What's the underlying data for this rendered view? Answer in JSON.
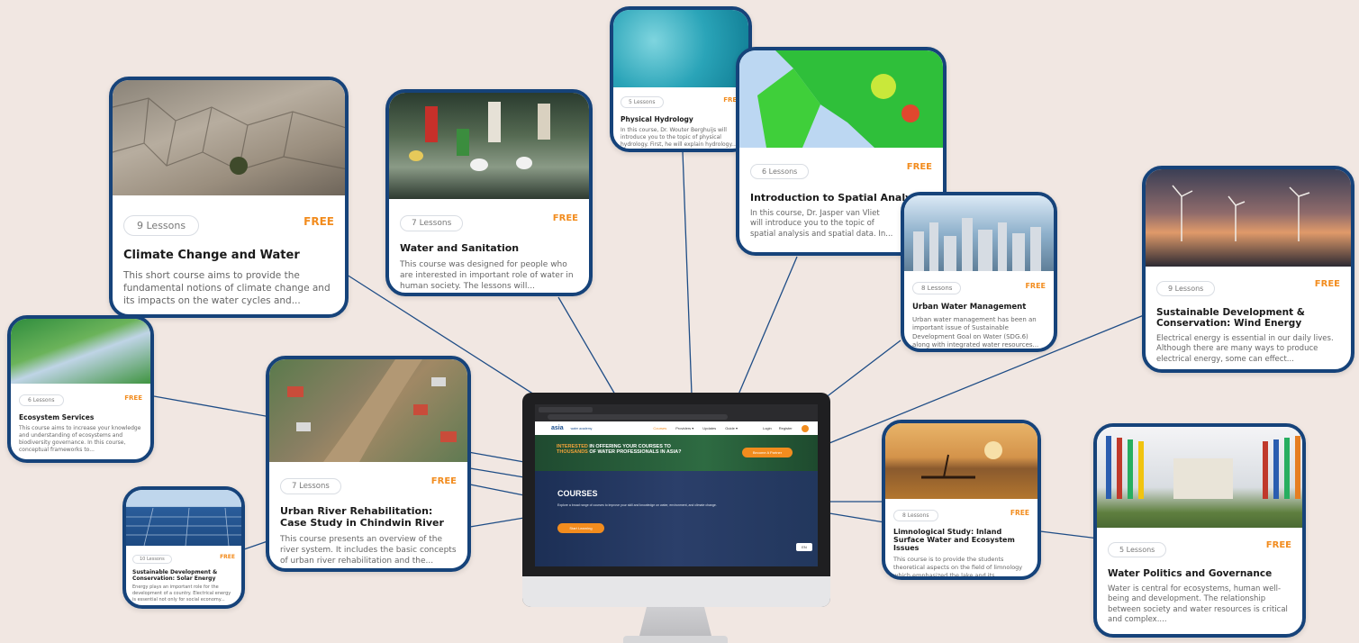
{
  "cards": {
    "climate": {
      "lessons": "9 Lessons",
      "free": "FREE",
      "title": "Climate Change and Water",
      "desc": "This short course aims to provide the fundamental notions of climate change and its impacts on the water cycles and..."
    },
    "sanitation": {
      "lessons": "7 Lessons",
      "free": "FREE",
      "title": "Water and Sanitation",
      "desc": "This course was designed for people who are interested in important role of water in human society. The lessons will..."
    },
    "hydrology": {
      "lessons": "5 Lessons",
      "free": "FREE",
      "title": "Physical Hydrology",
      "desc": "In this course, Dr. Wouter Berghuijs will introduce you to the topic of physical hydrology. First, he will explain hydrology..."
    },
    "spatial": {
      "lessons": "6 Lessons",
      "free": "FREE",
      "title": "Introduction to Spatial Analysis",
      "desc": "In this course, Dr. Jasper van Vliet will introduce you to the topic of spatial analysis and spatial data. In..."
    },
    "urban": {
      "lessons": "8 Lessons",
      "free": "FREE",
      "title": "Urban Water Management",
      "desc": "Urban water management has been an important issue of Sustainable Development Goal on Water (SDG.6) along with integrated water resources..."
    },
    "wind": {
      "lessons": "9 Lessons",
      "free": "FREE",
      "title": "Sustainable Development & Conservation: Wind Energy",
      "desc": "Electrical energy is essential in our daily lives. Although there are many ways to produce electrical energy, some can effect..."
    },
    "ecosystem": {
      "lessons": "6 Lessons",
      "free": "FREE",
      "title": "Ecosystem Services",
      "desc": "This course aims to increase your knowledge and understanding of ecosystems and biodiversity governance. In this course, conceptual frameworks to..."
    },
    "river": {
      "lessons": "7 Lessons",
      "free": "FREE",
      "title": "Urban River Rehabilitation: Case Study in Chindwin River",
      "desc": "This course presents an overview of the river system. It includes the basic concepts of urban river rehabilitation and the..."
    },
    "solar": {
      "lessons": "10 Lessons",
      "free": "FREE",
      "title": "Sustainable Development & Conservation: Solar Energy",
      "desc": "Energy plays an important role for the development of a country. Electrical energy is essential not only for social economy..."
    },
    "limnology": {
      "lessons": "8 Lessons",
      "free": "FREE",
      "title": "Limnological Study: Inland Surface Water and Ecosystem Issues",
      "desc": "This course is to provide the students theoretical aspects on the field of limnology which emphasized the lake and its..."
    },
    "politics": {
      "lessons": "5 Lessons",
      "free": "FREE",
      "title": "Water Politics and Governance",
      "desc": "Water is central for ecosystems, human well-being and development. The relationship between society and water resources is critical and complex...."
    }
  },
  "site": {
    "logo": "asia",
    "logo_sub": "water academy",
    "nav": [
      "Courses",
      "Providers ▾",
      "Updates",
      "Guide ▾"
    ],
    "login": "Login",
    "register": "Register",
    "banner_highlight": "INTERESTED",
    "banner_text": "IN OFFERING YOUR COURSES TO",
    "banner_highlight2": "THOUSANDS",
    "banner_text2": "OF WATER PROFESSIONALS IN ASIA?",
    "banner_button": "Become A Partner",
    "courses_heading": "COURSES",
    "courses_sub": "Explore a broad range of courses to improve your skill and knowledge on water, environment, and climate change.",
    "start_button": "Start Learning",
    "lang": "EN"
  },
  "colors": {
    "border": "#16437a",
    "accent": "#f28c1e",
    "background": "#f1e7e2"
  }
}
